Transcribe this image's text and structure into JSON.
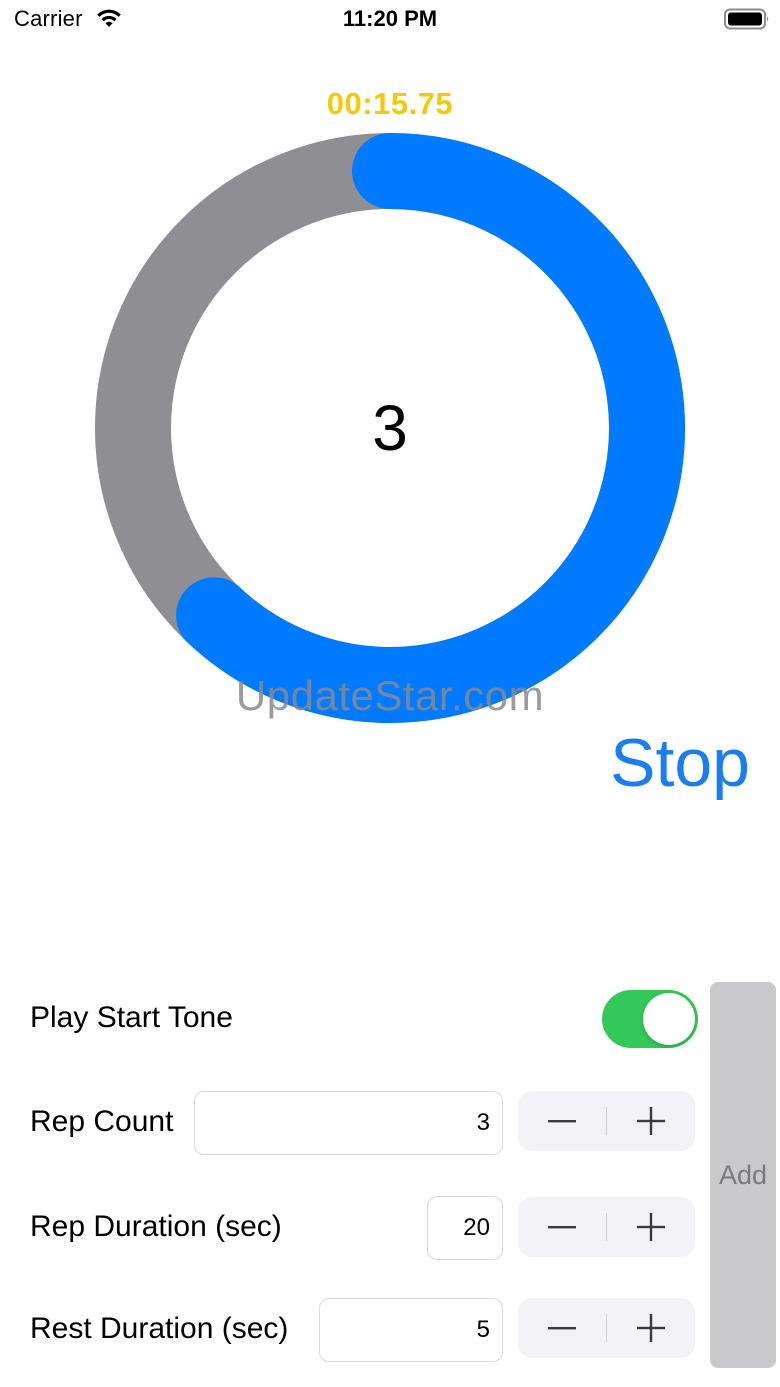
{
  "status_bar": {
    "carrier": "Carrier",
    "time": "11:20 PM",
    "wifi_icon": "wifi-icon",
    "battery_icon": "battery-icon"
  },
  "timer": {
    "elapsed": "00:15.75",
    "rep_number": "3",
    "progress_fraction": 0.62,
    "progress_color": "#007aff",
    "track_color": "#8e8e93",
    "elapsed_color": "#f5c90a"
  },
  "watermark": "UpdateStar.com",
  "stop_label": "Stop",
  "settings": {
    "play_start_tone": {
      "label": "Play Start Tone",
      "on": true,
      "on_color": "#34c759"
    },
    "rep_count": {
      "label": "Rep Count",
      "value": "3"
    },
    "rep_duration": {
      "label": "Rep Duration (sec)",
      "value": "20"
    },
    "rest_duration": {
      "label": "Rest Duration (sec)",
      "value": "5"
    },
    "stepper_icons": {
      "decrement": "minus-icon",
      "increment": "plus-icon"
    }
  },
  "add_label": "Add"
}
